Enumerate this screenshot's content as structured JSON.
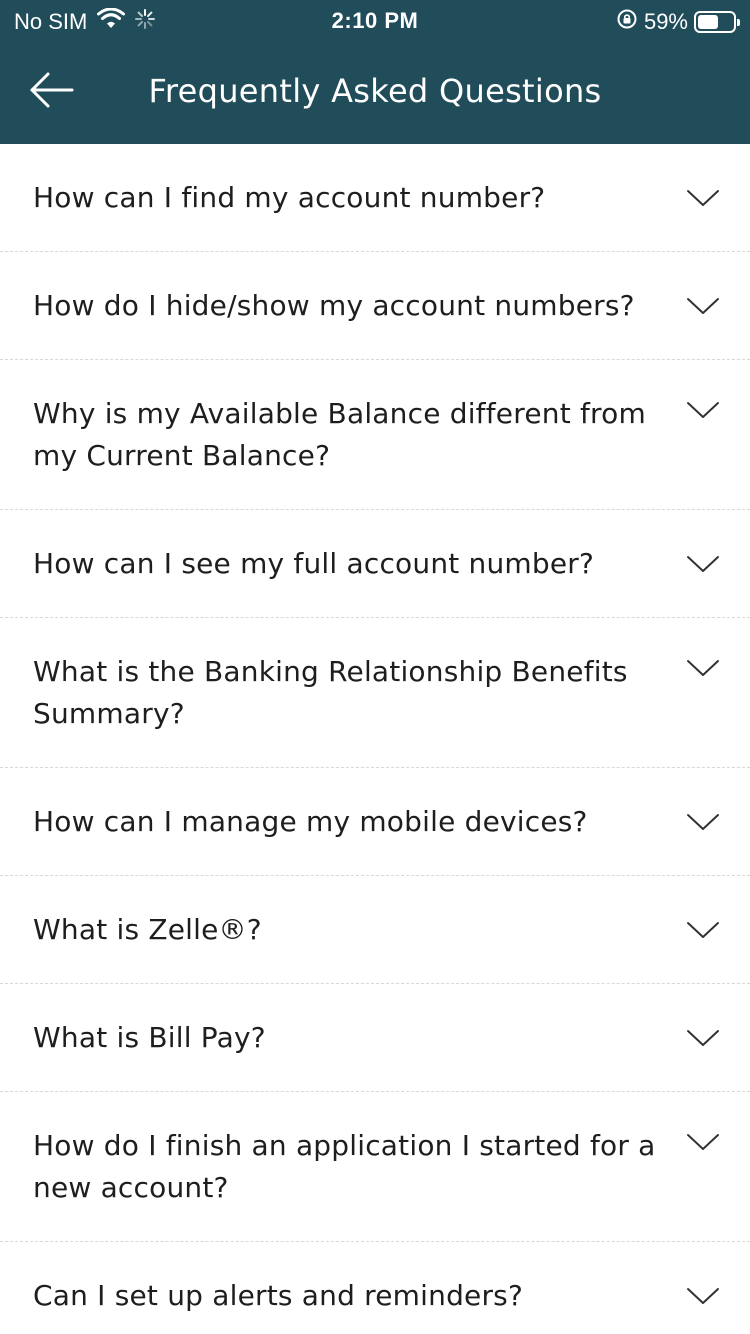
{
  "status_bar": {
    "carrier": "No SIM",
    "time": "2:10 PM",
    "battery_percent": "59%",
    "battery_level": 0.59,
    "icons": [
      "wifi-icon",
      "loading-icon",
      "orientation-lock-icon",
      "battery-icon"
    ]
  },
  "header": {
    "back_icon": "back-arrow-icon",
    "title": "Frequently Asked Questions"
  },
  "colors": {
    "header_bg": "#214d5b",
    "header_text": "#ffffff",
    "body_bg": "#ffffff",
    "divider": "#d8d8d8"
  },
  "faq": {
    "items": [
      {
        "question": "How can I find my account number?"
      },
      {
        "question": "How do I hide/show my account numbers?"
      },
      {
        "question": "Why is my Available Balance different from my Current Balance?"
      },
      {
        "question": "How can I see my full account number?"
      },
      {
        "question": "What is the Banking Relationship Benefits Summary?"
      },
      {
        "question": "How can I manage my mobile devices?"
      },
      {
        "question": "What is Zelle®?"
      },
      {
        "question": "What is Bill Pay?"
      },
      {
        "question": "How do I finish an application I started for a new account?"
      },
      {
        "question": "Can I set up alerts and reminders?"
      }
    ],
    "expand_icon": "chevron-down-icon"
  }
}
